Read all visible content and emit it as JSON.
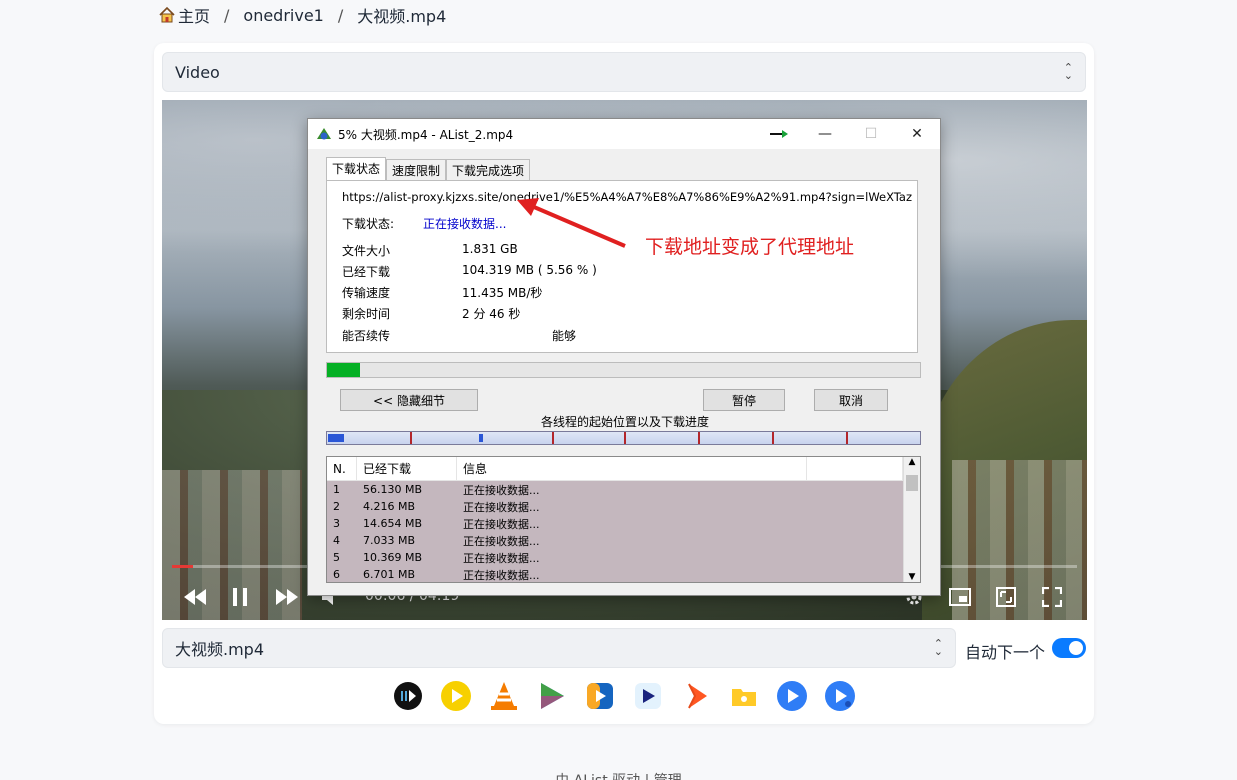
{
  "breadcrumb": {
    "home": "主页",
    "sep1": "/",
    "folder": "onedrive1",
    "sep2": "/",
    "file": "大视频.mp4"
  },
  "source_select": {
    "value": "Video"
  },
  "player": {
    "time": "00:06 / 04:19",
    "progress": 0.023
  },
  "download_window": {
    "title": "5% 大视频.mp4 - AList_2.mp4",
    "tabs": [
      "下载状态",
      "速度限制",
      "下载完成选项"
    ],
    "url": "https://alist-proxy.kjzxs.site/onedrive1/%E5%A4%A7%E8%A7%86%E9%A2%91.mp4?sign=lWeXTaz",
    "status_label": "下载状态:",
    "status_value": "正在接收数据...",
    "rows": [
      {
        "k": "文件大小",
        "v": "1.831  GB"
      },
      {
        "k": "已经下载",
        "v": "104.319  MB ( 5.56 % )"
      },
      {
        "k": "传输速度",
        "v": "11.435  MB/秒"
      },
      {
        "k": "剩余时间",
        "v": "2 分 46 秒"
      },
      {
        "k": "能否续传",
        "v": "能够"
      }
    ],
    "progress": 0.0556,
    "btn_hide": "<< 隐藏细节",
    "btn_pause": "暂停",
    "btn_cancel": "取消",
    "threads_label": "各线程的起始位置以及下载进度",
    "list_headers": [
      "N.",
      "已经下载",
      "信息"
    ],
    "list_rows": [
      {
        "n": "1",
        "d": "56.130 MB",
        "i": "正在接收数据..."
      },
      {
        "n": "2",
        "d": "4.216 MB",
        "i": "正在接收数据..."
      },
      {
        "n": "3",
        "d": "14.654 MB",
        "i": "正在接收数据..."
      },
      {
        "n": "4",
        "d": "7.033 MB",
        "i": "正在接收数据..."
      },
      {
        "n": "5",
        "d": "10.369 MB",
        "i": "正在接收数据..."
      },
      {
        "n": "6",
        "d": "6.701 MB",
        "i": "正在接收数据..."
      }
    ]
  },
  "annotation": "下载地址变成了代理地址",
  "file_select": {
    "value": "大视频.mp4"
  },
  "auto_next": {
    "label": "自动下一个",
    "on": true
  },
  "external_players": [
    "iina-icon",
    "potplayer-icon",
    "vlc-icon",
    "nplayer-icon",
    "omniplayer-icon",
    "figplayer-icon",
    "infuse-icon",
    "fileball-icon",
    "mx-player-icon",
    "mx-player-pro-icon"
  ],
  "footer": "由 AList 驱动 | 管理"
}
